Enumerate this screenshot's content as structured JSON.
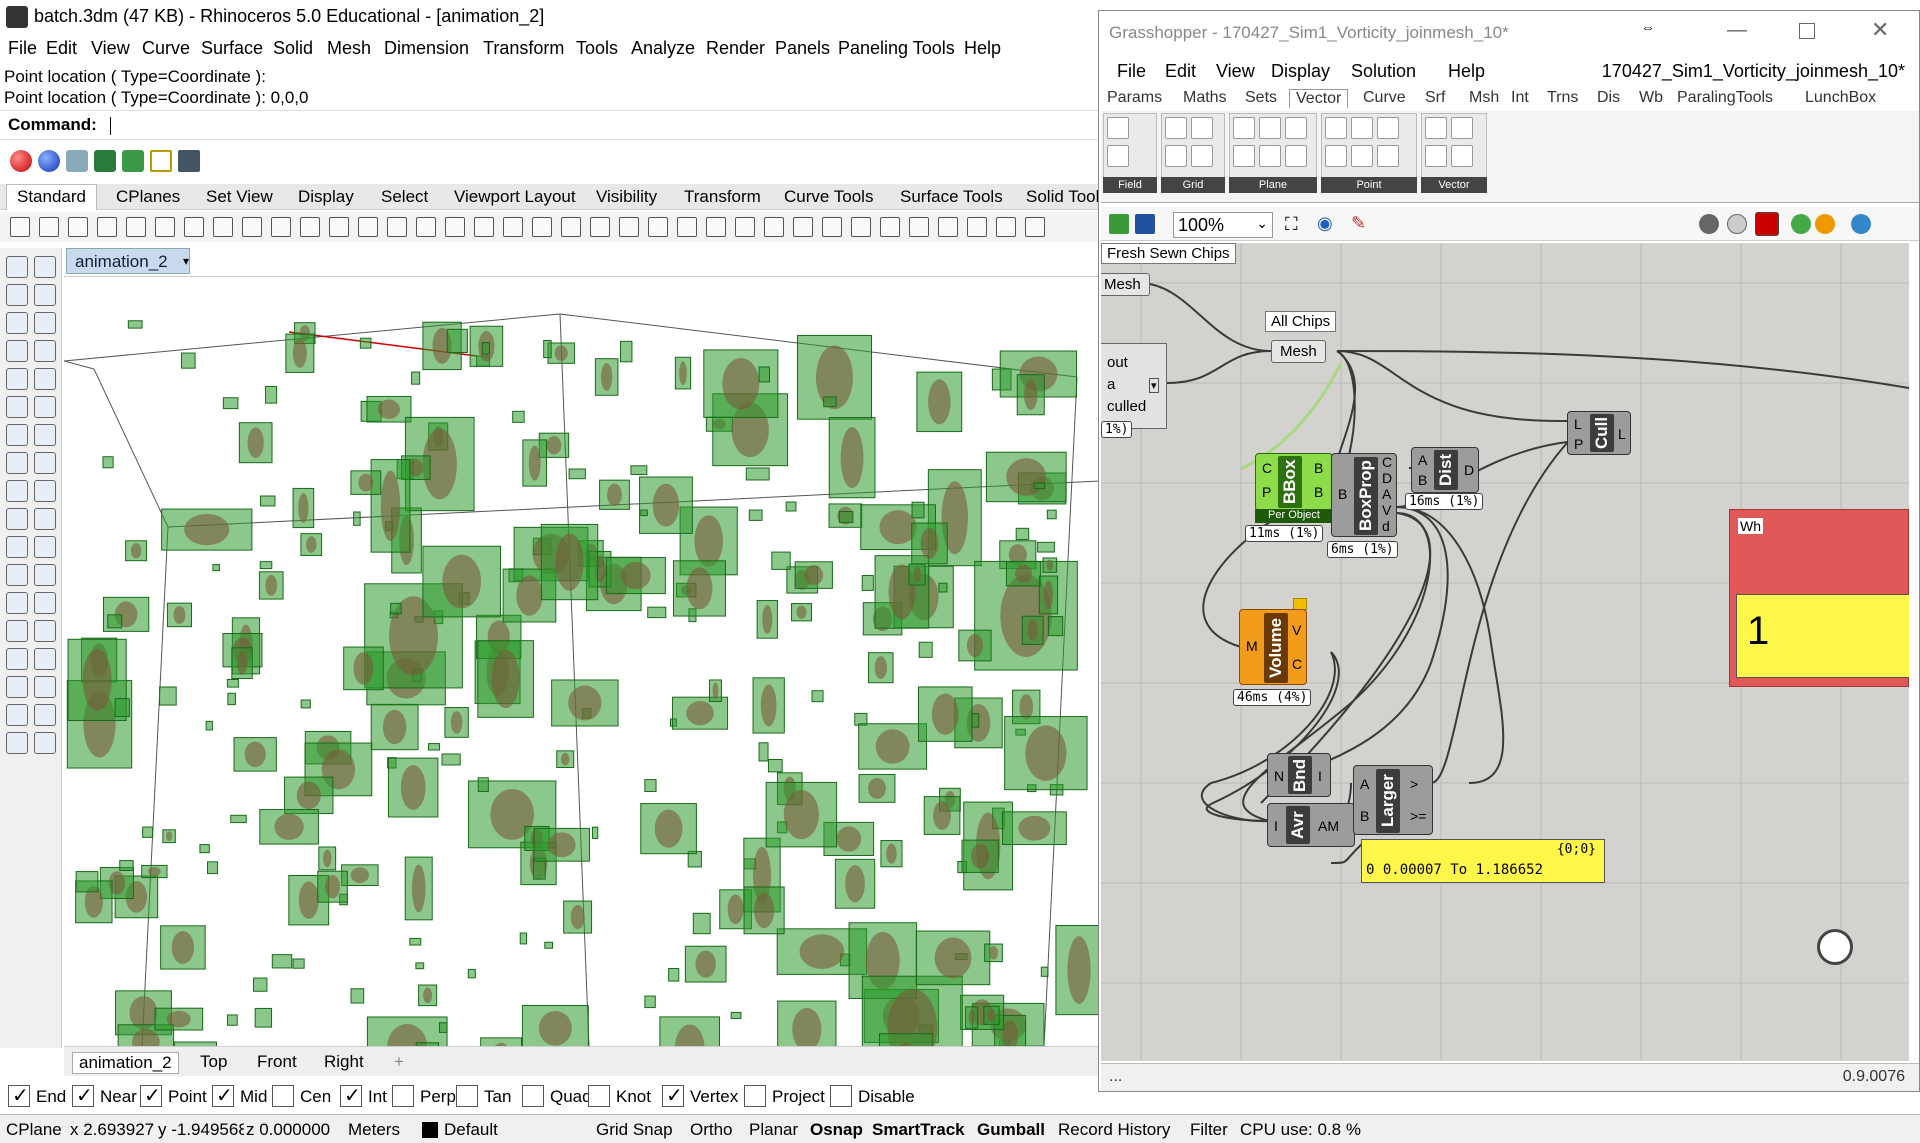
{
  "rhino": {
    "title": "batch.3dm (47 KB) - Rhinoceros 5.0 Educational - [animation_2]",
    "menu": [
      "File",
      "Edit",
      "View",
      "Curve",
      "Surface",
      "Solid",
      "Mesh",
      "Dimension",
      "Transform",
      "Tools",
      "Analyze",
      "Render",
      "Panels",
      "Paneling Tools",
      "Help"
    ],
    "history": [
      "Point location ( Type=Coordinate ):",
      "Point location ( Type=Coordinate ): 0,0,0"
    ],
    "command_label": "Command:",
    "tabs": [
      "Standard",
      "CPlanes",
      "Set View",
      "Display",
      "Select",
      "Viewport Layout",
      "Visibility",
      "Transform",
      "Curve Tools",
      "Surface Tools",
      "Solid Tool"
    ],
    "viewport_title": "animation_2",
    "viewport_tabs": [
      "animation_2",
      "Top",
      "Front",
      "Right"
    ],
    "osnaps": [
      {
        "label": "End",
        "checked": true
      },
      {
        "label": "Near",
        "checked": true
      },
      {
        "label": "Point",
        "checked": true
      },
      {
        "label": "Mid",
        "checked": true
      },
      {
        "label": "Cen",
        "checked": false
      },
      {
        "label": "Int",
        "checked": true
      },
      {
        "label": "Perp",
        "checked": false
      },
      {
        "label": "Tan",
        "checked": false
      },
      {
        "label": "Quad",
        "checked": false
      },
      {
        "label": "Knot",
        "checked": false
      },
      {
        "label": "Vertex",
        "checked": true
      },
      {
        "label": "Project",
        "checked": false
      },
      {
        "label": "Disable",
        "checked": false
      }
    ],
    "status": {
      "cplane": "CPlane",
      "x": "x 2.693927",
      "y": "y -1.949568",
      "z": "z 0.000000",
      "units": "Meters",
      "layer": "Default",
      "grid_snap": "Grid Snap",
      "ortho": "Ortho",
      "planar": "Planar",
      "osnap": "Osnap",
      "smarttrack": "SmartTrack",
      "gumball": "Gumball",
      "record_history": "Record History",
      "filter": "Filter",
      "cpu": "CPU use: 0.8 %"
    }
  },
  "gh": {
    "title": "Grasshopper - 170427_Sim1_Vorticity_joinmesh_10*",
    "menu": [
      "File",
      "Edit",
      "View",
      "Display",
      "Solution",
      "Help"
    ],
    "file_name": "170427_Sim1_Vorticity_joinmesh_10*",
    "tabs": [
      "Params",
      "Maths",
      "Sets",
      "Vector",
      "Curve",
      "Srf",
      "Msh",
      "Int",
      "Trns",
      "Dis",
      "Wb",
      "ParalingTools",
      "LunchBox"
    ],
    "ribbon_groups": [
      "Field",
      "Grid",
      "Plane",
      "Point",
      "Vector"
    ],
    "zoom": "100%",
    "status_left": "...",
    "status_right": "0.9.0076",
    "canvas": {
      "group_fresh": "Fresh Sewn Chips",
      "mesh_param_left": "Mesh",
      "group_all": "All Chips",
      "mesh_param": "Mesh",
      "stream_outputs": [
        "out",
        "a",
        "culled"
      ],
      "stream_pct": "1%)",
      "bbox": {
        "name": "BBox",
        "in": [
          "C",
          "P"
        ],
        "out": [
          "B",
          "B"
        ],
        "footer": "Per Object",
        "timing": "11ms (1%)"
      },
      "boxprop": {
        "name": "BoxProp",
        "in": [
          "B"
        ],
        "out": [
          "C",
          "D",
          "A",
          "V",
          "d"
        ],
        "timing": "6ms (1%)"
      },
      "dist": {
        "name": "Dist",
        "in": [
          "A",
          "B"
        ],
        "out": [
          "D"
        ],
        "timing": "16ms (1%)"
      },
      "cull": {
        "name": "Cull",
        "in": [
          "L",
          "P"
        ],
        "out": [
          "L"
        ]
      },
      "volume": {
        "name": "Volume",
        "in": [
          "M"
        ],
        "out": [
          "V",
          "C"
        ],
        "timing": "46ms (4%)"
      },
      "bnd": {
        "name": "Bnd",
        "in": [
          "N"
        ],
        "out": [
          "I"
        ]
      },
      "avr": {
        "name": "Avr",
        "in": [
          "I"
        ],
        "out": [
          "AM"
        ]
      },
      "larger": {
        "name": "Larger",
        "in": [
          "A",
          "B"
        ],
        "out": [
          ">",
          ">="
        ]
      },
      "panel_header": "{0;0}",
      "panel_value": "0 0.00007 To 1.186652",
      "red_group_label": "Wh",
      "yellow_big": "1"
    }
  }
}
